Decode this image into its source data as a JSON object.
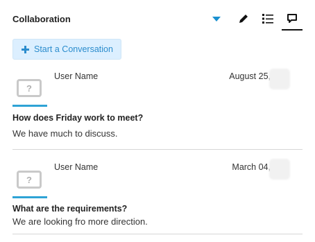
{
  "header": {
    "title": "Collaboration",
    "icons": [
      "chevron-down-icon",
      "pencil-icon",
      "list-view-icon",
      "chat-view-icon"
    ],
    "accent": "#1a90d0"
  },
  "start_button": {
    "label": "Start a Conversation",
    "icon": "plus-icon"
  },
  "conversations": [
    {
      "user": "User Name",
      "date": "August 25, ",
      "title": "How does Friday work to meet?",
      "body": "We have much to discuss."
    },
    {
      "user": "User Name",
      "date": "March 04, ",
      "title": "What are the requirements?",
      "body": "We are looking fro more direction."
    }
  ],
  "colors": {
    "accent_bar": "#2ea3d5",
    "button_bg": "#dcefff",
    "button_text": "#2b8ccd"
  }
}
